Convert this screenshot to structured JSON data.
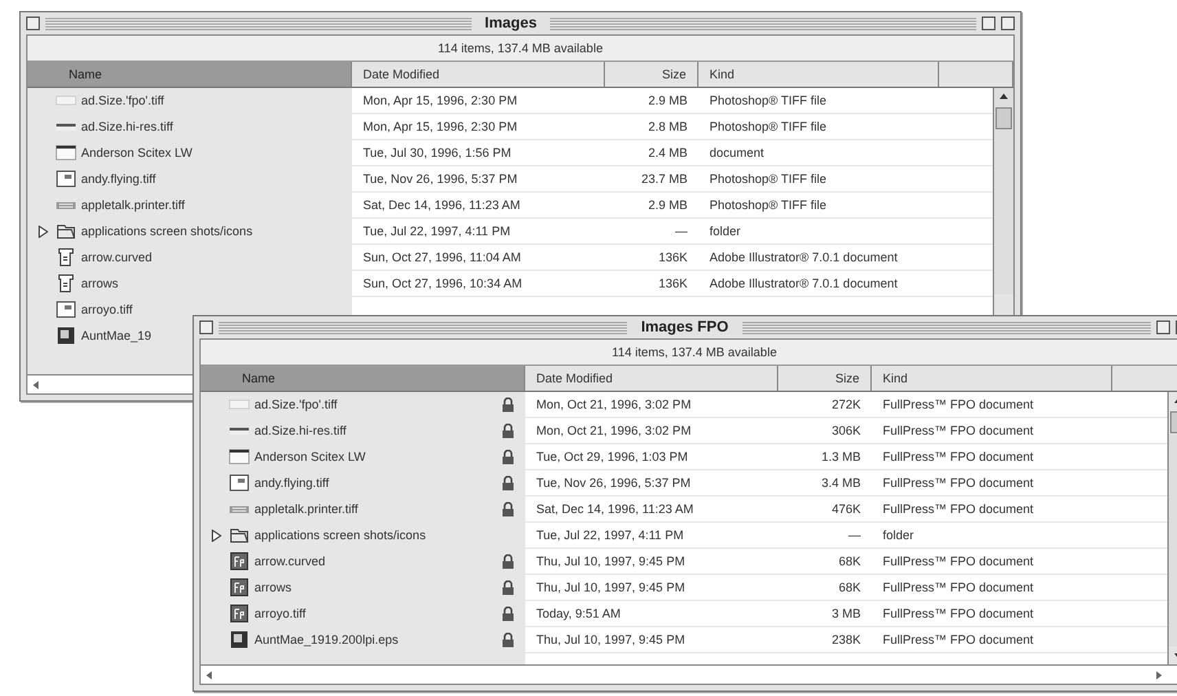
{
  "windows": [
    {
      "title": "Images",
      "info": "114 items, 137.4 MB available",
      "columns": [
        {
          "label": "Name",
          "sorted": true
        },
        {
          "label": "Date Modified",
          "sorted": false
        },
        {
          "label": "Size",
          "sorted": false
        },
        {
          "label": "Kind",
          "sorted": false
        }
      ],
      "rows": [
        {
          "kind": "blank",
          "name": "ad.Size.'fpo'.tiff",
          "date": "Mon, Apr 15, 1996, 2:30 PM",
          "size": "2.9 MB",
          "file_kind": "Photoshop® TIFF file"
        },
        {
          "kind": "line",
          "name": "ad.Size.hi-res.tiff",
          "date": "Mon, Apr 15, 1996, 2:30 PM",
          "size": "2.8 MB",
          "file_kind": "Photoshop® TIFF file"
        },
        {
          "kind": "strip",
          "name": "Anderson Scitex LW",
          "date": "Tue, Jul 30, 1996, 1:56 PM",
          "size": "2.4 MB",
          "file_kind": "document"
        },
        {
          "kind": "image",
          "name": "andy.flying.tiff",
          "date": "Tue, Nov 26, 1996, 5:37 PM",
          "size": "23.7 MB",
          "file_kind": "Photoshop® TIFF file"
        },
        {
          "kind": "printer",
          "name": "appletalk.printer.tiff",
          "date": "Sat, Dec 14, 1996, 11:23 AM",
          "size": "2.9 MB",
          "file_kind": "Photoshop® TIFF file"
        },
        {
          "kind": "folder",
          "expanded": false,
          "name": "applications screen shots/icons",
          "date": "Tue, Jul 22, 1997, 4:11 PM",
          "size": "—",
          "file_kind": "folder"
        },
        {
          "kind": "illustrator",
          "name": "arrow.curved",
          "date": "Sun, Oct 27, 1996, 11:04 AM",
          "size": "136K",
          "file_kind": "Adobe Illustrator® 7.0.1 document"
        },
        {
          "kind": "illustrator",
          "name": "arrows",
          "date": "Sun, Oct 27, 1996, 10:34 AM",
          "size": "136K",
          "file_kind": "Adobe Illustrator® 7.0.1 document"
        },
        {
          "kind": "image",
          "name": "arroyo.tiff"
        },
        {
          "kind": "photo",
          "name": "AuntMae_19"
        }
      ]
    },
    {
      "title": "Images FPO",
      "info": "114 items, 137.4 MB available",
      "columns": [
        {
          "label": "Name",
          "sorted": true
        },
        {
          "label": "Date Modified",
          "sorted": false
        },
        {
          "label": "Size",
          "sorted": false
        },
        {
          "label": "Kind",
          "sorted": false
        }
      ],
      "rows": [
        {
          "kind": "blank",
          "name": "ad.Size.'fpo'.tiff",
          "locked": true,
          "date": "Mon, Oct 21, 1996, 3:02 PM",
          "size": "272K",
          "file_kind": "FullPress™ FPO document"
        },
        {
          "kind": "line",
          "name": "ad.Size.hi-res.tiff",
          "locked": true,
          "date": "Mon, Oct 21, 1996, 3:02 PM",
          "size": "306K",
          "file_kind": "FullPress™ FPO document"
        },
        {
          "kind": "strip",
          "name": "Anderson Scitex LW",
          "locked": true,
          "date": "Tue, Oct 29, 1996, 1:03 PM",
          "size": "1.3 MB",
          "file_kind": "FullPress™ FPO document"
        },
        {
          "kind": "image",
          "name": "andy.flying.tiff",
          "locked": true,
          "date": "Tue, Nov 26, 1996, 5:37 PM",
          "size": "3.4 MB",
          "file_kind": "FullPress™ FPO document"
        },
        {
          "kind": "printer",
          "name": "appletalk.printer.tiff",
          "locked": true,
          "date": "Sat, Dec 14, 1996, 11:23 AM",
          "size": "476K",
          "file_kind": "FullPress™ FPO document"
        },
        {
          "kind": "folder",
          "expanded": false,
          "name": "applications screen shots/icons",
          "locked": false,
          "date": "Tue, Jul 22, 1997, 4:11 PM",
          "size": "—",
          "file_kind": "folder"
        },
        {
          "kind": "fullpress",
          "name": "arrow.curved",
          "locked": true,
          "date": "Thu, Jul 10, 1997, 9:45 PM",
          "size": "68K",
          "file_kind": "FullPress™ FPO document"
        },
        {
          "kind": "fullpress",
          "name": "arrows",
          "locked": true,
          "date": "Thu, Jul 10, 1997, 9:45 PM",
          "size": "68K",
          "file_kind": "FullPress™ FPO document"
        },
        {
          "kind": "fullpress",
          "name": "arroyo.tiff",
          "locked": true,
          "date": "Today, 9:51 AM",
          "size": "3 MB",
          "file_kind": "FullPress™ FPO document"
        },
        {
          "kind": "photo",
          "name": "AuntMae_1919.200lpi.eps",
          "locked": true,
          "date": "Thu, Jul 10, 1997, 9:45 PM",
          "size": "238K",
          "file_kind": "FullPress™ FPO document"
        }
      ]
    }
  ]
}
